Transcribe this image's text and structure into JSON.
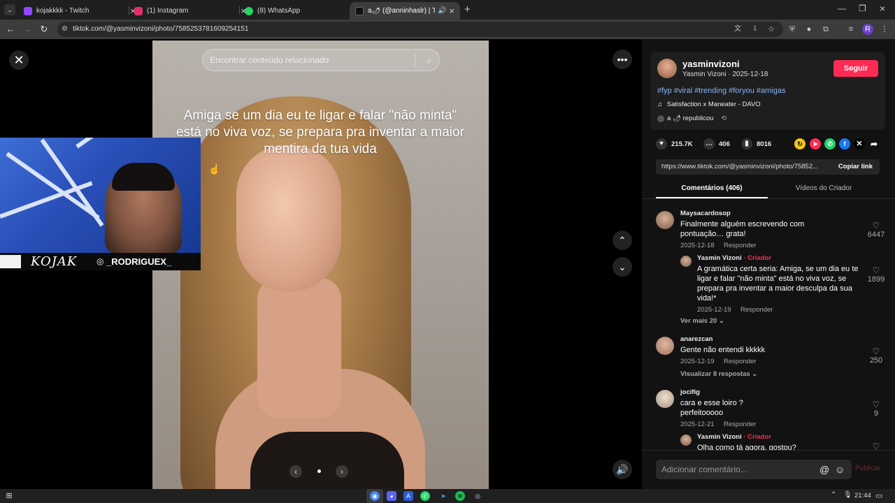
{
  "browser": {
    "tabs": [
      {
        "title": "kojakkkk - Twitch",
        "icon": "twitch-icon",
        "color": "#9146ff",
        "active": false
      },
      {
        "title": "(1) Instagram",
        "icon": "instagram-icon",
        "color": "#e1306c",
        "active": false
      },
      {
        "title": "(8) WhatsApp",
        "icon": "whatsapp-icon",
        "color": "#25d366",
        "active": false
      },
      {
        "title": "a🌶 (@anninhaslr) | TikTok",
        "icon": "tiktok-icon",
        "color": "#111111",
        "active": true
      }
    ],
    "url": "tiktok.com/@yasminvizoni/photo/7585253781609254151",
    "profile_initial": "R"
  },
  "video": {
    "search_placeholder": "Encontrar conteúdo relacionado",
    "caption": "Amiga se um dia eu te ligar e falar \"não minta\" está no viva voz, se prepara pra inventar a maior mentira da tua vida"
  },
  "webcam": {
    "logo_text": "KOJAK",
    "handle": "_RODRIGUEX_"
  },
  "post": {
    "username": "yasminvizoni",
    "display_name": "Yasmin Vizoni",
    "date": "2025-12-18",
    "follow_label": "Seguir",
    "hashtags": "#fyp #viral #trending #foryou #amigas",
    "music": "Satisfaction x Maneater - DAVO",
    "repost_user": "a",
    "repost_text": "republicou",
    "likes": "215.7K",
    "comments_count": "406",
    "saves": "8016",
    "link": "https://www.tiktok.com/@yasminvizoni/photo/75852...",
    "copy_label": "Copiar link",
    "tab_comments": "Comentários (406)",
    "tab_videos": "Vídeos do Criador"
  },
  "comments": [
    {
      "user": "Maysacardosop",
      "text": "Finalmente alguém escrevendo com pontuação… grata!",
      "date": "2025-12-18",
      "reply": "Responder",
      "likes": "6447"
    },
    {
      "user": "Yasmin Vizoni",
      "creator": "· Criador",
      "text": "A gramática certa seria: Amiga, se um dia eu te ligar e falar \"não minta\" está no viva voz, se prepara pra inventar a maior desculpa da sua vida!*",
      "date": "2025-12-19",
      "reply": "Responder",
      "likes": "1899"
    },
    {
      "more": "Ver mais 20"
    },
    {
      "user": "anarezcan",
      "text": "Gente não entendi kkkkk",
      "date": "2025-12-19",
      "reply": "Responder",
      "likes": "250"
    },
    {
      "more": "Visualizar 8 respostas"
    },
    {
      "user": "jocifig",
      "text": "cara e esse loiro ?\nperfeitooooo",
      "date": "2025-12-21",
      "reply": "Responder",
      "likes": "9"
    },
    {
      "user": "Yasmin Vizoni",
      "creator": "· Criador",
      "text": "Olha como tá agora, gostou?"
    }
  ],
  "composer": {
    "placeholder": "Adicionar comentário...",
    "publish_label": "Publicar"
  },
  "taskbar": {
    "time": "21:44"
  }
}
